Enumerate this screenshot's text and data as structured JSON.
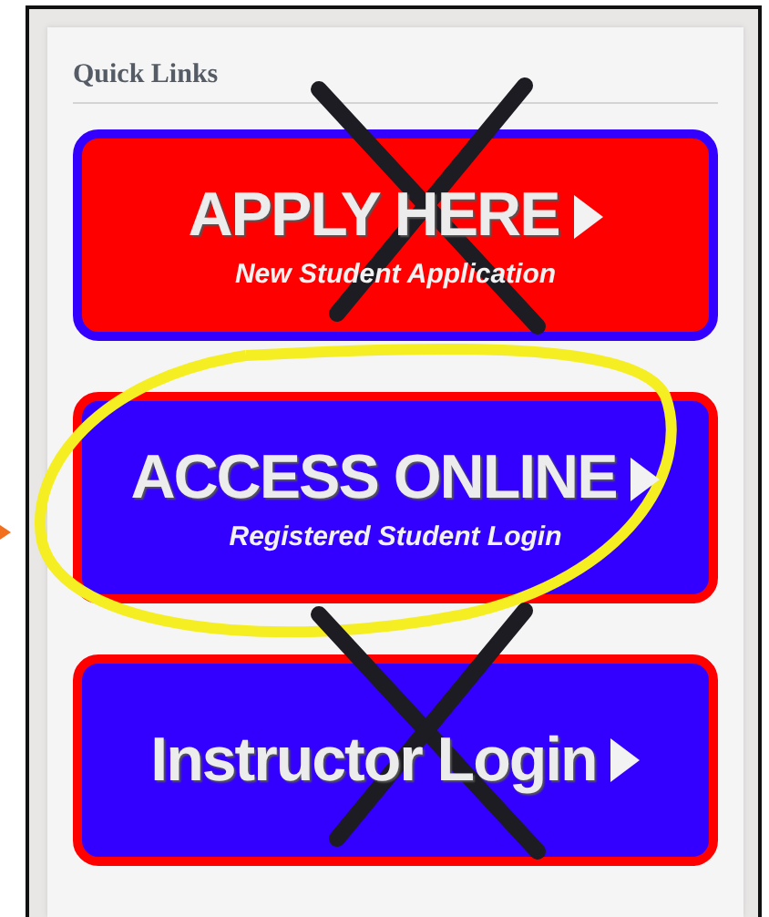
{
  "panel": {
    "title": "Quick Links"
  },
  "buttons": [
    {
      "title": "APPLY HERE",
      "subtitle": "New Student Application",
      "color": "#ff0000",
      "crossed_out": true,
      "circled": false
    },
    {
      "title": "ACCESS ONLINE",
      "subtitle": "Registered Student Login",
      "color": "#3300ff",
      "crossed_out": false,
      "circled": true
    },
    {
      "title": "Instructor Login",
      "color": "#3300ff",
      "crossed_out": true,
      "circled": false
    }
  ]
}
